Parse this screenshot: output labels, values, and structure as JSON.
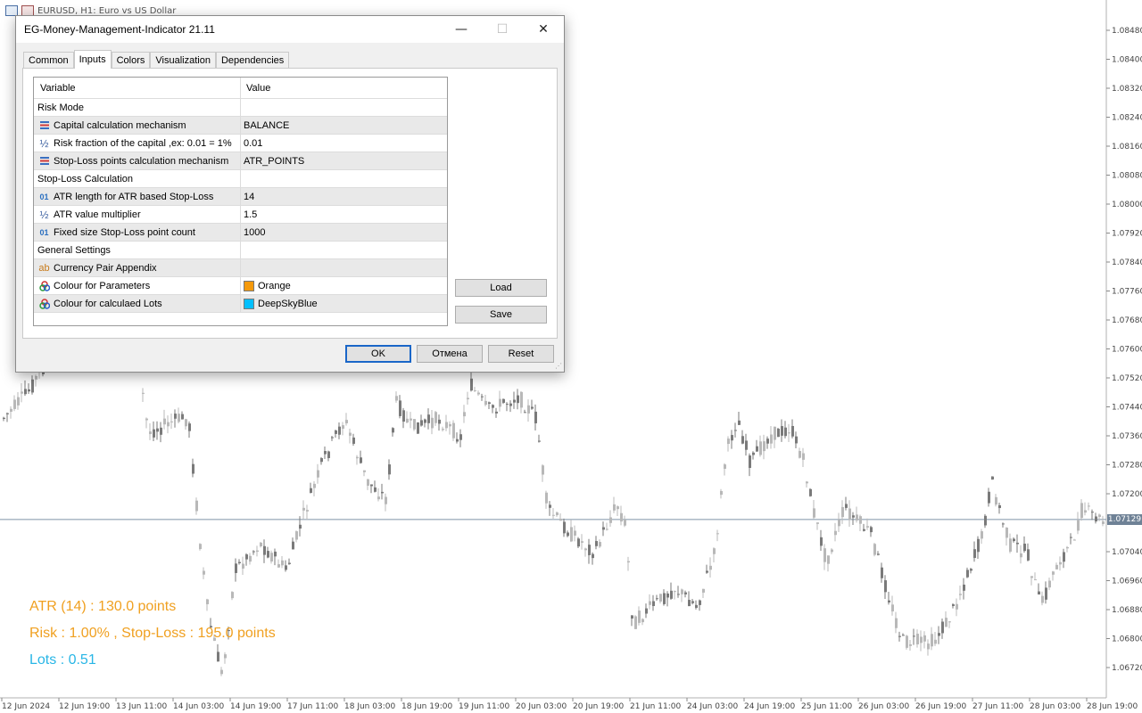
{
  "chart": {
    "title": "EURUSD, H1: Euro vs US Dollar",
    "current_price": "1.07129",
    "price_labels": [
      "1.08480",
      "1.08400",
      "1.08320",
      "1.08240",
      "1.08160",
      "1.08080",
      "1.08000",
      "1.07920",
      "1.07840",
      "1.07760",
      "1.07680",
      "1.07600",
      "1.07520",
      "1.07440",
      "1.07360",
      "1.07280",
      "1.07200",
      "1.07040",
      "1.06960",
      "1.06880",
      "1.06800",
      "1.06720"
    ],
    "time_labels": [
      "12 Jun 2024",
      "12 Jun 19:00",
      "13 Jun 11:00",
      "14 Jun 03:00",
      "14 Jun 19:00",
      "17 Jun 11:00",
      "18 Jun 03:00",
      "18 Jun 19:00",
      "19 Jun 11:00",
      "20 Jun 03:00",
      "20 Jun 19:00",
      "21 Jun 11:00",
      "24 Jun 03:00",
      "24 Jun 19:00",
      "25 Jun 11:00",
      "26 Jun 03:00",
      "26 Jun 19:00",
      "27 Jun 11:00",
      "28 Jun 03:00",
      "28 Jun 19:00"
    ],
    "overlay": {
      "atr": "ATR (14) : 130.0 points",
      "risk": "Risk : 1.00% , Stop-Loss : 195.0 points",
      "lots": "Lots : 0.51"
    },
    "colors": {
      "overlay_orange": "#f0a020",
      "overlay_blue": "#29b6e6",
      "candle": "#8c8c8c",
      "price_line": "#7f93a8"
    }
  },
  "dialog": {
    "title": "EG-Money-Management-Indicator 21.11",
    "window_buttons": {
      "minimize": "—",
      "maximize": "☐",
      "close": "✕"
    },
    "tabs": [
      "Common",
      "Inputs",
      "Colors",
      "Visualization",
      "Dependencies"
    ],
    "active_tab": "Inputs",
    "table": {
      "headers": {
        "variable": "Variable",
        "value": "Value"
      },
      "rows": [
        {
          "type": "section",
          "label": "Risk Mode",
          "value": ""
        },
        {
          "type": "enum",
          "icon": "enum-icon",
          "label": "Capital calculation mechanism",
          "value": "BALANCE"
        },
        {
          "type": "double",
          "icon": "fraction-icon",
          "label": "Risk fraction of the capital ,ex: 0.01 = 1%",
          "value": "0.01"
        },
        {
          "type": "enum",
          "icon": "enum-icon",
          "label": "Stop-Loss points calculation mechanism",
          "value": "ATR_POINTS"
        },
        {
          "type": "section",
          "label": "Stop-Loss Calculation",
          "value": ""
        },
        {
          "type": "int",
          "icon": "integer-icon",
          "label": "ATR length for ATR based Stop-Loss",
          "value": "14"
        },
        {
          "type": "double",
          "icon": "fraction-icon",
          "label": "ATR value multiplier",
          "value": "1.5"
        },
        {
          "type": "int",
          "icon": "integer-icon",
          "label": "Fixed size Stop-Loss point count",
          "value": "1000"
        },
        {
          "type": "section",
          "label": "General Settings",
          "value": ""
        },
        {
          "type": "string",
          "icon": "string-icon",
          "label": "Currency Pair Appendix",
          "value": ""
        },
        {
          "type": "color",
          "icon": "color-icon",
          "label": "Colour for Parameters",
          "value": "Orange",
          "swatch": "#f59a0c"
        },
        {
          "type": "color",
          "icon": "color-icon",
          "label": "Colour for calculaed Lots",
          "value": "DeepSkyBlue",
          "swatch": "#00bfff"
        }
      ]
    },
    "buttons": {
      "load": "Load",
      "save": "Save",
      "ok": "OK",
      "cancel": "Отмена",
      "reset": "Reset"
    }
  }
}
